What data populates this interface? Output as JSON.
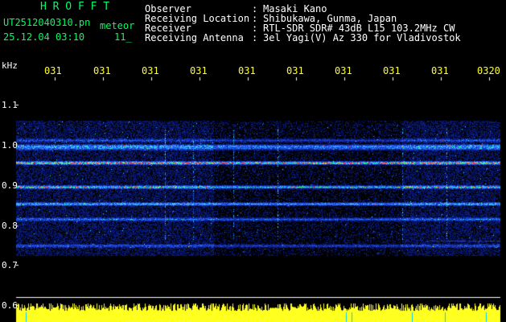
{
  "header": {
    "program_title": "H R O F F T",
    "filename": "UT2512040310.pn",
    "filename_suffix": "meteor",
    "date_time": "25.12.04 03:10",
    "index": "11_"
  },
  "info": {
    "labels": [
      "Observer",
      "Receiving Location",
      "Receiver",
      "Receiving Antenna"
    ],
    "separator": ":",
    "values": [
      "Masaki Kano",
      "Shibukawa, Gunma, Japan",
      "RTL-SDR SDR# 43dB L15 103.2MHz CW",
      "3el Yagi(V) Az 330 for Vladivostok"
    ]
  },
  "axis": {
    "unit": "kHz",
    "y_ticks": [
      "1.1",
      "1.0",
      "0.9",
      "0.8",
      "0.7",
      "0.6"
    ],
    "x_ticks": [
      "031",
      "031",
      "031",
      "031",
      "031",
      "031",
      "031",
      "031",
      "031",
      "0320"
    ]
  },
  "colors": {
    "background": "#000000",
    "title_green": "#00ff60",
    "tick_yellow": "#ffff20",
    "text_white": "#ffffff"
  }
}
